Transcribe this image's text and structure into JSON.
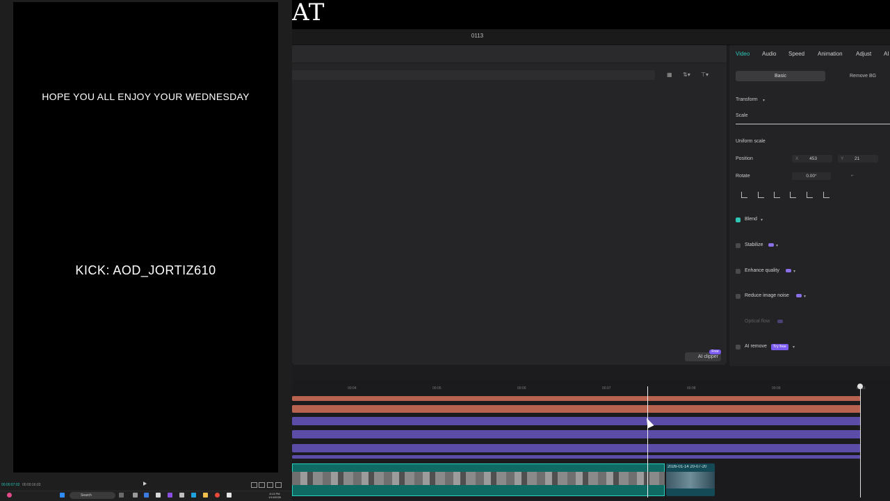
{
  "header": {
    "brand_text": "AT",
    "project_title": "0113"
  },
  "preview": {
    "overlay_text_1": "HOPE YOU ALL ENJOY YOUR WEDNESDAY",
    "overlay_text_2": "KICK: AOD_JORTIZ610",
    "timecode_current": "00:00:07:02",
    "timecode_total": "00:00:16:03"
  },
  "taskbar": {
    "search_label": "Search",
    "time": "8:13 PM",
    "date": "1/14/2026"
  },
  "inspector": {
    "tabs": [
      "Video",
      "Audio",
      "Speed",
      "Animation",
      "Adjust",
      "AI"
    ],
    "active_tab": "Video",
    "subtabs": [
      "Basic",
      "Remove BG"
    ],
    "transform_label": "Transform",
    "scale_label": "Scale",
    "uniform_scale_label": "Uniform scale",
    "position_label": "Position",
    "position_x_label": "X",
    "position_x": "453",
    "position_y_label": "Y",
    "position_y": "21",
    "rotate_label": "Rotate",
    "rotate_value": "0.00°",
    "blend_label": "Blend",
    "stabilize_label": "Stabilize",
    "enhance_quality_label": "Enhance quality",
    "reduce_noise_label": "Reduce image noise",
    "optical_flow_label": "Optical flow",
    "ai_remove_label": "AI remove",
    "try_free_label": "Try free"
  },
  "media": {
    "ai_clipper_label": "AI clipper",
    "free_badge": "Free"
  },
  "timeline": {
    "ticks": [
      "00:04",
      "00:05",
      "00:06",
      "00:07",
      "00:08",
      "00:09",
      "00:10"
    ],
    "clip2_label": "2026-01-14 20-07-20"
  },
  "colors": {
    "accent": "#2fc6b6",
    "red_track": "#b86350",
    "purple_track": "#5b4ca8",
    "video_track": "#0f6a64"
  }
}
